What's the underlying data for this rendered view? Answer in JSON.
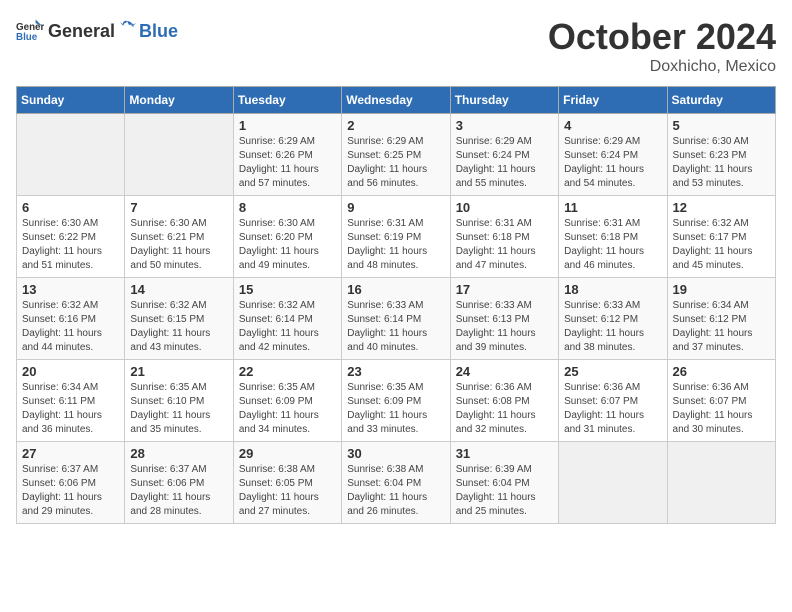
{
  "header": {
    "logo_general": "General",
    "logo_blue": "Blue",
    "month": "October 2024",
    "location": "Doxhicho, Mexico"
  },
  "weekdays": [
    "Sunday",
    "Monday",
    "Tuesday",
    "Wednesday",
    "Thursday",
    "Friday",
    "Saturday"
  ],
  "weeks": [
    [
      null,
      null,
      {
        "day": 1,
        "sunrise": "6:29 AM",
        "sunset": "6:26 PM",
        "daylight": "11 hours and 57 minutes."
      },
      {
        "day": 2,
        "sunrise": "6:29 AM",
        "sunset": "6:25 PM",
        "daylight": "11 hours and 56 minutes."
      },
      {
        "day": 3,
        "sunrise": "6:29 AM",
        "sunset": "6:24 PM",
        "daylight": "11 hours and 55 minutes."
      },
      {
        "day": 4,
        "sunrise": "6:29 AM",
        "sunset": "6:24 PM",
        "daylight": "11 hours and 54 minutes."
      },
      {
        "day": 5,
        "sunrise": "6:30 AM",
        "sunset": "6:23 PM",
        "daylight": "11 hours and 53 minutes."
      }
    ],
    [
      {
        "day": 6,
        "sunrise": "6:30 AM",
        "sunset": "6:22 PM",
        "daylight": "11 hours and 51 minutes."
      },
      {
        "day": 7,
        "sunrise": "6:30 AM",
        "sunset": "6:21 PM",
        "daylight": "11 hours and 50 minutes."
      },
      {
        "day": 8,
        "sunrise": "6:30 AM",
        "sunset": "6:20 PM",
        "daylight": "11 hours and 49 minutes."
      },
      {
        "day": 9,
        "sunrise": "6:31 AM",
        "sunset": "6:19 PM",
        "daylight": "11 hours and 48 minutes."
      },
      {
        "day": 10,
        "sunrise": "6:31 AM",
        "sunset": "6:18 PM",
        "daylight": "11 hours and 47 minutes."
      },
      {
        "day": 11,
        "sunrise": "6:31 AM",
        "sunset": "6:18 PM",
        "daylight": "11 hours and 46 minutes."
      },
      {
        "day": 12,
        "sunrise": "6:32 AM",
        "sunset": "6:17 PM",
        "daylight": "11 hours and 45 minutes."
      }
    ],
    [
      {
        "day": 13,
        "sunrise": "6:32 AM",
        "sunset": "6:16 PM",
        "daylight": "11 hours and 44 minutes."
      },
      {
        "day": 14,
        "sunrise": "6:32 AM",
        "sunset": "6:15 PM",
        "daylight": "11 hours and 43 minutes."
      },
      {
        "day": 15,
        "sunrise": "6:32 AM",
        "sunset": "6:14 PM",
        "daylight": "11 hours and 42 minutes."
      },
      {
        "day": 16,
        "sunrise": "6:33 AM",
        "sunset": "6:14 PM",
        "daylight": "11 hours and 40 minutes."
      },
      {
        "day": 17,
        "sunrise": "6:33 AM",
        "sunset": "6:13 PM",
        "daylight": "11 hours and 39 minutes."
      },
      {
        "day": 18,
        "sunrise": "6:33 AM",
        "sunset": "6:12 PM",
        "daylight": "11 hours and 38 minutes."
      },
      {
        "day": 19,
        "sunrise": "6:34 AM",
        "sunset": "6:12 PM",
        "daylight": "11 hours and 37 minutes."
      }
    ],
    [
      {
        "day": 20,
        "sunrise": "6:34 AM",
        "sunset": "6:11 PM",
        "daylight": "11 hours and 36 minutes."
      },
      {
        "day": 21,
        "sunrise": "6:35 AM",
        "sunset": "6:10 PM",
        "daylight": "11 hours and 35 minutes."
      },
      {
        "day": 22,
        "sunrise": "6:35 AM",
        "sunset": "6:09 PM",
        "daylight": "11 hours and 34 minutes."
      },
      {
        "day": 23,
        "sunrise": "6:35 AM",
        "sunset": "6:09 PM",
        "daylight": "11 hours and 33 minutes."
      },
      {
        "day": 24,
        "sunrise": "6:36 AM",
        "sunset": "6:08 PM",
        "daylight": "11 hours and 32 minutes."
      },
      {
        "day": 25,
        "sunrise": "6:36 AM",
        "sunset": "6:07 PM",
        "daylight": "11 hours and 31 minutes."
      },
      {
        "day": 26,
        "sunrise": "6:36 AM",
        "sunset": "6:07 PM",
        "daylight": "11 hours and 30 minutes."
      }
    ],
    [
      {
        "day": 27,
        "sunrise": "6:37 AM",
        "sunset": "6:06 PM",
        "daylight": "11 hours and 29 minutes."
      },
      {
        "day": 28,
        "sunrise": "6:37 AM",
        "sunset": "6:06 PM",
        "daylight": "11 hours and 28 minutes."
      },
      {
        "day": 29,
        "sunrise": "6:38 AM",
        "sunset": "6:05 PM",
        "daylight": "11 hours and 27 minutes."
      },
      {
        "day": 30,
        "sunrise": "6:38 AM",
        "sunset": "6:04 PM",
        "daylight": "11 hours and 26 minutes."
      },
      {
        "day": 31,
        "sunrise": "6:39 AM",
        "sunset": "6:04 PM",
        "daylight": "11 hours and 25 minutes."
      },
      null,
      null
    ]
  ]
}
